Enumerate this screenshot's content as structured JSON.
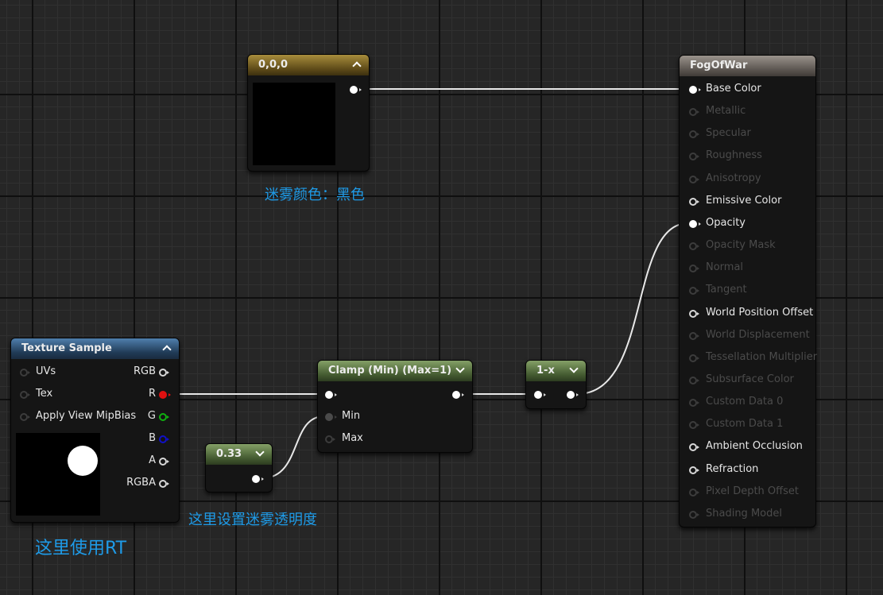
{
  "texture_sample": {
    "title": "Texture Sample",
    "inputs": [
      "UVs",
      "Tex",
      "Apply View MipBias"
    ],
    "outputs": [
      "RGB",
      "R",
      "G",
      "B",
      "A",
      "RGBA"
    ]
  },
  "constant_color": {
    "title": "0,0,0"
  },
  "constant_033": {
    "title": "0.33"
  },
  "clamp": {
    "title": "Clamp (Min) (Max=1)",
    "inputs": [
      "Min",
      "Max"
    ]
  },
  "one_minus": {
    "title": "1-x"
  },
  "material": {
    "title": "FogOfWar",
    "pins": [
      {
        "label": "Base Color",
        "state": "connected"
      },
      {
        "label": "Metallic",
        "state": "disabled"
      },
      {
        "label": "Specular",
        "state": "disabled"
      },
      {
        "label": "Roughness",
        "state": "disabled"
      },
      {
        "label": "Anisotropy",
        "state": "disabled"
      },
      {
        "label": "Emissive Color",
        "state": "enabled"
      },
      {
        "label": "Opacity",
        "state": "connected"
      },
      {
        "label": "Opacity Mask",
        "state": "disabled"
      },
      {
        "label": "Normal",
        "state": "disabled"
      },
      {
        "label": "Tangent",
        "state": "disabled"
      },
      {
        "label": "World Position Offset",
        "state": "enabled"
      },
      {
        "label": "World Displacement",
        "state": "disabled"
      },
      {
        "label": "Tessellation Multiplier",
        "state": "disabled"
      },
      {
        "label": "Subsurface Color",
        "state": "disabled"
      },
      {
        "label": "Custom Data 0",
        "state": "disabled"
      },
      {
        "label": "Custom Data 1",
        "state": "disabled"
      },
      {
        "label": "Ambient Occlusion",
        "state": "enabled"
      },
      {
        "label": "Refraction",
        "state": "enabled"
      },
      {
        "label": "Pixel Depth Offset",
        "state": "disabled"
      },
      {
        "label": "Shading Model",
        "state": "disabled"
      }
    ]
  },
  "comments": {
    "fog_color": "迷雾颜色：黑色",
    "use_rt": "这里使用RT",
    "fog_opacity": "这里设置迷雾透明度"
  },
  "colors": {
    "comment": "#1e9be8",
    "wire": "#e8e8e8",
    "pin_r": "#e01010",
    "pin_g": "#10b010",
    "pin_b": "#1010c8"
  }
}
